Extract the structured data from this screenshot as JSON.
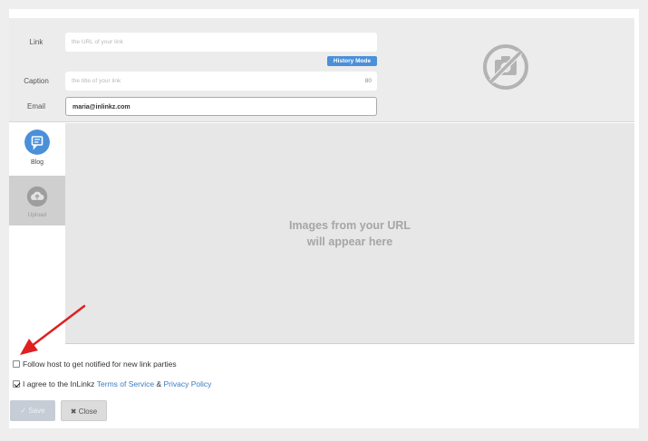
{
  "form": {
    "link_label": "Link",
    "link_placeholder": "the URL of your link",
    "history_mode_label": "History Mode",
    "caption_label": "Caption",
    "caption_placeholder": "the title of your link",
    "caption_counter": "80",
    "email_label": "Email",
    "email_value": "maria@inlinkz.com"
  },
  "tabs": [
    {
      "label": "Blog",
      "icon": "blog-icon",
      "active": true
    },
    {
      "label": "Upload",
      "icon": "upload-icon",
      "active": false
    }
  ],
  "preview": {
    "line1": "Images from your URL",
    "line2": "will appear here"
  },
  "options": {
    "follow_label": "Follow host to get notified for new link parties",
    "follow_checked": false,
    "agree_prefix": "I agree to the InLinkz",
    "terms_link": "Terms of Service",
    "agree_and": "&",
    "privacy_link": "Privacy Policy",
    "agree_checked": true
  },
  "buttons": {
    "save_label": "Save",
    "close_label": "Close"
  },
  "colors": {
    "accent": "#4a90d9",
    "arrow": "#e02020",
    "link": "#3a7bc0"
  }
}
